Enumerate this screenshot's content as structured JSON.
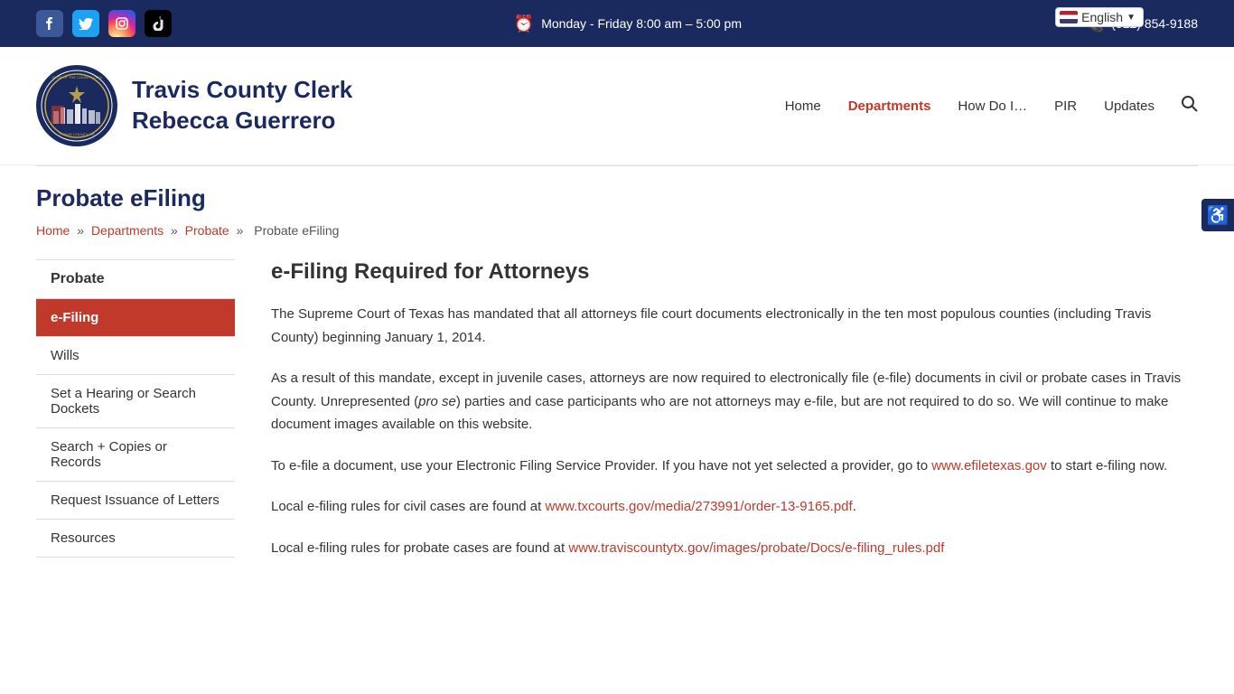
{
  "topbar": {
    "hours": "Monday - Friday 8:00 am – 5:00 pm",
    "phone": "(512) 854-9188",
    "social": [
      {
        "name": "facebook",
        "label": "f",
        "css_class": "fb-icon"
      },
      {
        "name": "twitter",
        "label": "🐦",
        "css_class": "tw-icon"
      },
      {
        "name": "instagram",
        "label": "📷",
        "css_class": "ig-icon"
      },
      {
        "name": "tiktok",
        "label": "♪",
        "css_class": "tt-icon"
      }
    ]
  },
  "language": {
    "current": "English"
  },
  "header": {
    "title_line1": "Travis County Clerk",
    "title_line2": "Rebecca Guerrero"
  },
  "nav": {
    "items": [
      {
        "label": "Home",
        "active": false
      },
      {
        "label": "Departments",
        "active": true
      },
      {
        "label": "How Do I…",
        "active": false
      },
      {
        "label": "PIR",
        "active": false
      },
      {
        "label": "Updates",
        "active": false
      }
    ]
  },
  "page": {
    "title": "Probate eFiling",
    "breadcrumb": [
      {
        "label": "Home",
        "link": true
      },
      {
        "label": "Departments",
        "link": true
      },
      {
        "label": "Probate",
        "link": true
      },
      {
        "label": "Probate eFiling",
        "link": false
      }
    ]
  },
  "sidebar": {
    "group": "Probate",
    "items": [
      {
        "label": "e-Filing",
        "active": true
      },
      {
        "label": "Wills",
        "active": false
      },
      {
        "label": "Set a Hearing or Search Dockets",
        "active": false
      },
      {
        "label": "Search + Copies or Records",
        "active": false
      },
      {
        "label": "Request Issuance of Letters",
        "active": false
      },
      {
        "label": "Resources",
        "active": false
      }
    ]
  },
  "content": {
    "title": "e-Filing Required for Attorneys",
    "paragraphs": [
      {
        "id": "p1",
        "text": "The Supreme Court of Texas has mandated that all attorneys file court documents electronically in the ten most populous counties (including Travis County) beginning January 1, 2014."
      },
      {
        "id": "p2",
        "text_parts": [
          {
            "text": "As a result of this mandate, except in juvenile cases, attorneys are now required to electronically file (e-file) documents in civil or probate cases in Travis County. Unrepresented ("
          },
          {
            "text": "pro se",
            "italic": true
          },
          {
            "text": ") parties and case participants who are not attorneys may e-file, but are not required to do so. We will continue to make document images available on this website."
          }
        ]
      },
      {
        "id": "p3",
        "text_before": "To e-file a document, use your Electronic Filing Service Provider. If you have not yet selected a provider, go to ",
        "link_text": "www.efiletexas.gov",
        "link_href": "http://www.efiletexas.gov",
        "text_after": " to start e-filing now."
      },
      {
        "id": "p4",
        "text_before": "Local e-filing rules for civil cases are found at ",
        "link_text": "www.txcourts.gov/media/273991/order-13-9165.pdf",
        "link_href": "http://www.txcourts.gov/media/273991/order-13-9165.pdf",
        "text_after": "."
      },
      {
        "id": "p5",
        "text_before": "Local e-filing rules for probate cases are found at ",
        "link_text": "www.traviscountytx.gov/images/probate/Docs/e-filing_rules.pdf",
        "link_href": "http://www.traviscountytx.gov/images/probate/Docs/e-filing_rules.pdf",
        "text_after": ""
      }
    ]
  }
}
